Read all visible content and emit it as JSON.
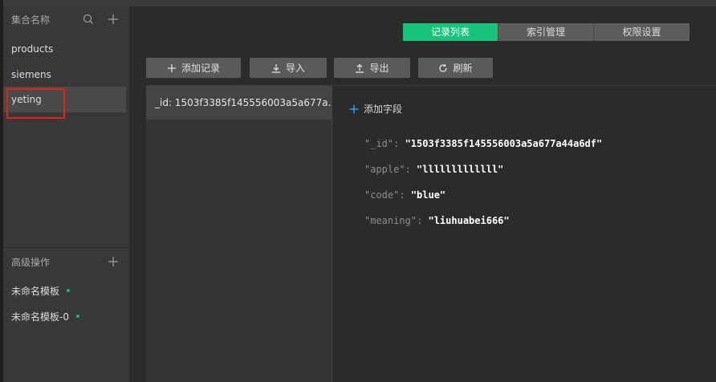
{
  "sidebar": {
    "collections_title": "集合名称",
    "collections": [
      {
        "label": "products"
      },
      {
        "label": "siemens"
      },
      {
        "label": "yeting"
      }
    ],
    "advanced_title": "高级操作",
    "templates": [
      {
        "label": "未命名模板"
      },
      {
        "label": "未命名模板-0"
      }
    ]
  },
  "tabs": [
    {
      "label": "记录列表"
    },
    {
      "label": "索引管理"
    },
    {
      "label": "权限设置"
    }
  ],
  "toolbar": {
    "add_record": "添加记录",
    "import": "导入",
    "export": "导出",
    "refresh": "刷新"
  },
  "records": [
    {
      "label": "_id: 1503f3385f145556003a5a677a..."
    }
  ],
  "detail": {
    "add_field": "添加字段",
    "fields": [
      {
        "key": "\"_id\"",
        "value": "\"1503f3385f145556003a5a677a44a6df\""
      },
      {
        "key": "\"apple\"",
        "value": "\"lllllllllllll\""
      },
      {
        "key": "\"code\"",
        "value": "\"blue\""
      },
      {
        "key": "\"meaning\"",
        "value": "\"liuhuabei666\""
      }
    ]
  },
  "colors": {
    "accent": "#17c27a",
    "highlight": "#e0221b",
    "status_dot": "#1db573"
  }
}
